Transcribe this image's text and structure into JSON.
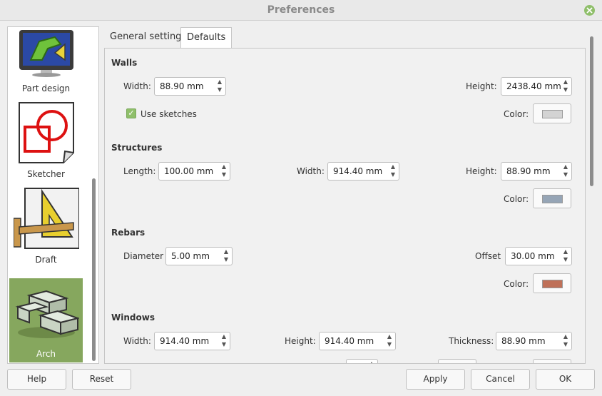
{
  "window": {
    "title": "Preferences"
  },
  "categories": [
    {
      "label": "Part design",
      "icon": "part-design-icon",
      "selected": false
    },
    {
      "label": "Sketcher",
      "icon": "sketcher-icon",
      "selected": false
    },
    {
      "label": "Draft",
      "icon": "draft-icon",
      "selected": false
    },
    {
      "label": "Arch",
      "icon": "arch-icon",
      "selected": true
    }
  ],
  "tabs": [
    {
      "label": "General settings",
      "active": false
    },
    {
      "label": "Defaults",
      "active": true
    }
  ],
  "walls": {
    "title": "Walls",
    "width_label": "Width:",
    "width_value": "88.90 mm",
    "height_label": "Height:",
    "height_value": "2438.40 mm",
    "use_sketches_label": "Use sketches",
    "use_sketches_checked": true,
    "color_label": "Color:",
    "color": "#d3d3d3"
  },
  "structures": {
    "title": "Structures",
    "length_label": "Length:",
    "length_value": "100.00 mm",
    "width_label": "Width:",
    "width_value": "914.40 mm",
    "height_label": "Height:",
    "height_value": "88.90 mm",
    "color_label": "Color:",
    "color": "#96a5b6"
  },
  "rebars": {
    "title": "Rebars",
    "diameter_label": "Diameter",
    "diameter_value": "5.00 mm",
    "offset_label": "Offset",
    "offset_value": "30.00 mm",
    "color_label": "Color:",
    "color": "#bf7058"
  },
  "windows": {
    "title": "Windows",
    "width_label": "Width:",
    "width_value": "914.40 mm",
    "height_label": "Height:",
    "height_value": "914.40 mm",
    "thickness_label": "Thickness:",
    "thickness_value": "88.90 mm"
  },
  "buttons": {
    "help": "Help",
    "reset": "Reset",
    "apply": "Apply",
    "cancel": "Cancel",
    "ok": "OK"
  },
  "colors": {
    "accent": "#86a75e",
    "check": "#8fbf6a"
  }
}
